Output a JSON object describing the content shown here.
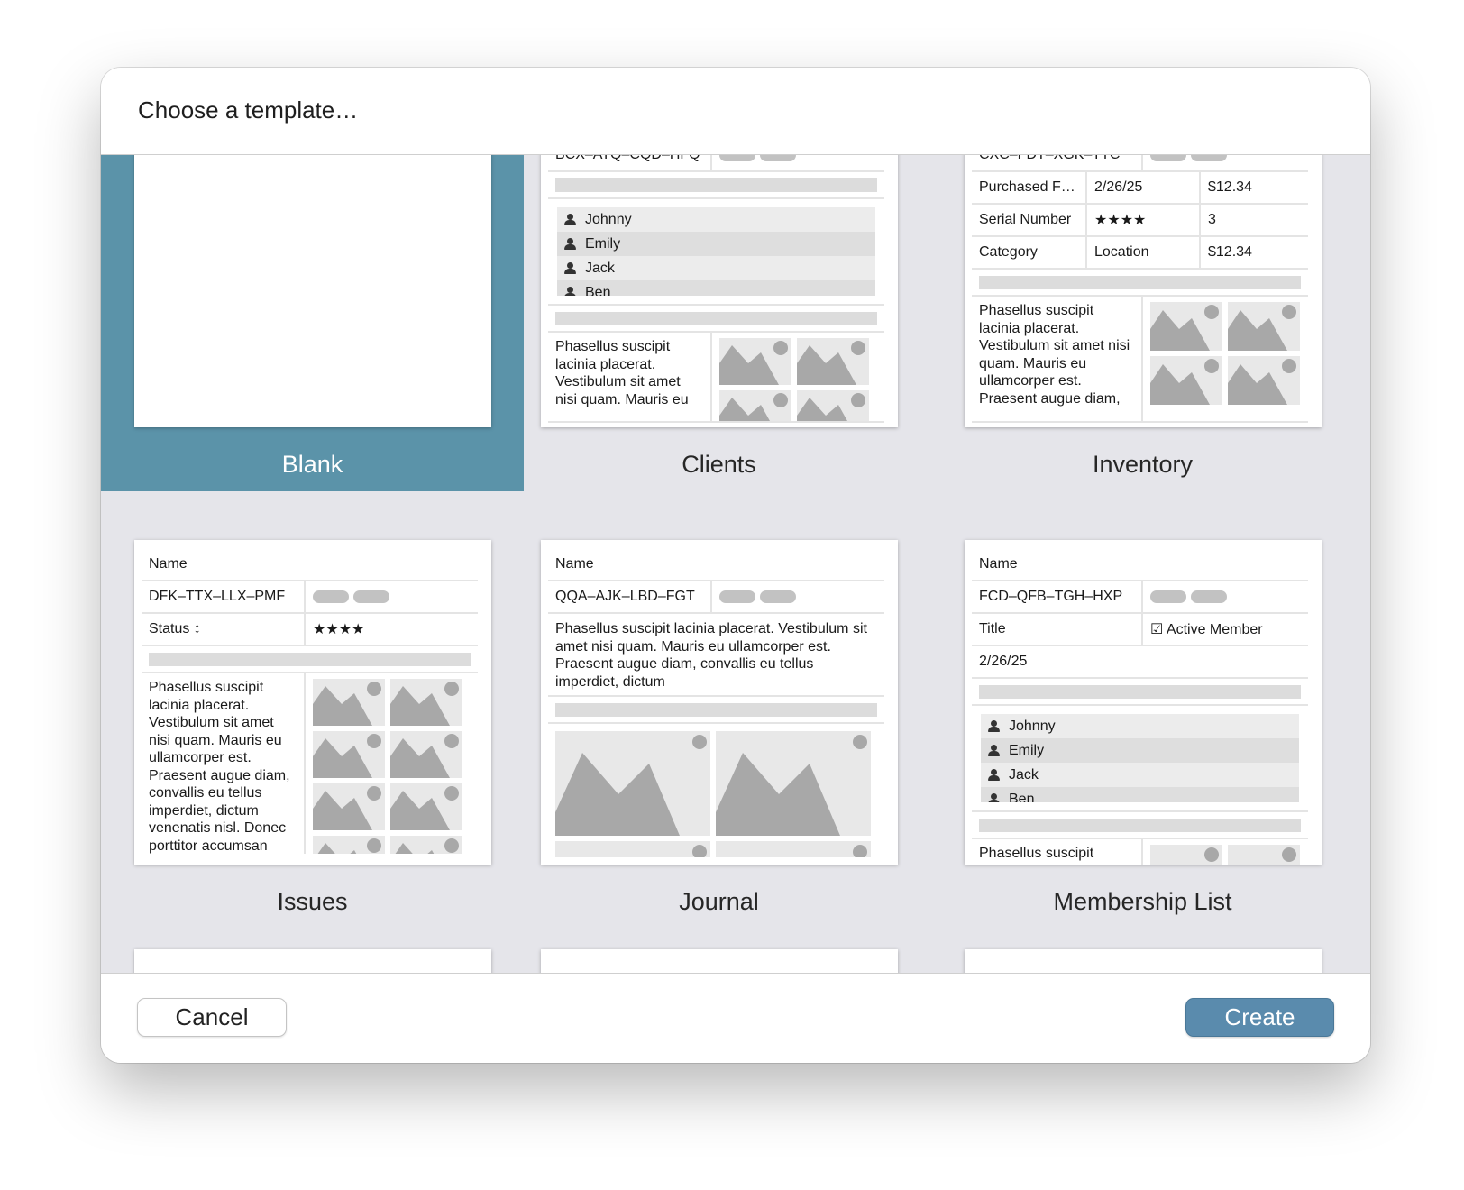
{
  "dialog": {
    "title": "Choose a template…"
  },
  "templates": {
    "blank": {
      "label": "Blank"
    },
    "clients": {
      "label": "Clients",
      "code": "BCX–ATQ–CQD–HFQ",
      "people": [
        "Johnny",
        "Emily",
        "Jack",
        "Ben"
      ],
      "text": "Phasellus suscipit lacinia placerat. Vestibulum sit amet nisi quam. Mauris eu"
    },
    "inventory": {
      "label": "Inventory",
      "code": "CXC–FDT–XGK–TTC",
      "r1": [
        "Purchased F…",
        "2/26/25",
        "$12.34"
      ],
      "r2": [
        "Serial Number",
        "★★★★",
        "3"
      ],
      "r3": [
        "Category",
        "Location",
        "$12.34"
      ],
      "text": "Phasellus suscipit lacinia placerat. Vestibulum sit amet nisi quam. Mauris eu ullamcorper est. Praesent augue diam,"
    },
    "issues": {
      "label": "Issues",
      "name": "Name",
      "code": "DFK–TTX–LLX–PMF",
      "status": "Status ↕",
      "stars": "★★★★",
      "text": "Phasellus suscipit lacinia placerat. Vestibulum sit amet nisi quam. Mauris eu ullamcorper est. Praesent augue diam, convallis eu tellus imperdiet, dictum venenatis nisl. Donec porttitor accumsan"
    },
    "journal": {
      "label": "Journal",
      "name": "Name",
      "code": "QQA–AJK–LBD–FGT",
      "text": "Phasellus suscipit lacinia placerat. Vestibulum sit amet nisi quam. Mauris eu ullamcorper est. Praesent augue diam, convallis eu tellus imperdiet, dictum"
    },
    "membership": {
      "label": "Membership List",
      "name": "Name",
      "code": "FCD–QFB–TGH–HXP",
      "title_field": "Title",
      "checkbox": "☑ Active Member",
      "date": "2/26/25",
      "people": [
        "Johnny",
        "Emily",
        "Jack",
        "Ben"
      ],
      "text": "Phasellus suscipit"
    }
  },
  "footer": {
    "cancel_label": "Cancel",
    "create_label": "Create"
  },
  "colors": {
    "selected": "#5b93a9",
    "create_button": "#5a8bad",
    "grid_background": "#e5e5ea"
  }
}
